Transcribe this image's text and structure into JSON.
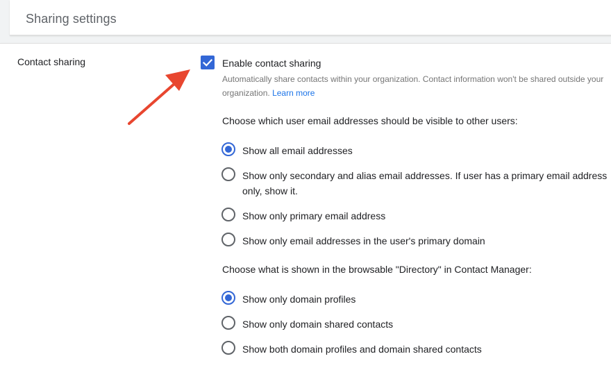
{
  "header": {
    "title": "Sharing settings"
  },
  "section": {
    "label": "Contact sharing",
    "checkbox": {
      "label": "Enable contact sharing",
      "checked": true,
      "description": "Automatically share contacts within your organization. Contact information won't be shared outside your organization.",
      "learn_more": "Learn more"
    },
    "email_question": "Choose which user email addresses should be visible to other users:",
    "email_options": [
      {
        "label": "Show all email addresses",
        "selected": true
      },
      {
        "label": "Show only secondary and alias email addresses. If user has a primary email address only, show it.",
        "selected": false
      },
      {
        "label": "Show only primary email address",
        "selected": false
      },
      {
        "label": "Show only email addresses in the user's primary domain",
        "selected": false
      }
    ],
    "directory_question": "Choose what is shown in the browsable \"Directory\" in Contact Manager:",
    "directory_options": [
      {
        "label": "Show only domain profiles",
        "selected": true
      },
      {
        "label": "Show only domain shared contacts",
        "selected": false
      },
      {
        "label": "Show both domain profiles and domain shared contacts",
        "selected": false
      }
    ]
  },
  "colors": {
    "accent": "#3367d6",
    "link": "#1a73e8",
    "annotation_arrow": "#e8462f"
  }
}
